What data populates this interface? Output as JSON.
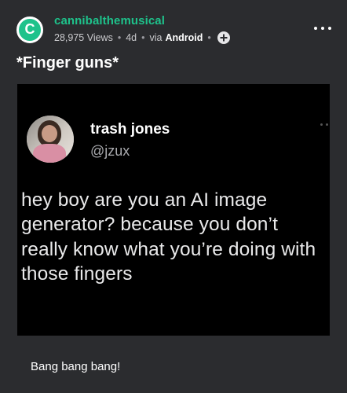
{
  "post": {
    "author": "cannibalthemusical",
    "avatar_letter": "C",
    "views": "28,975 Views",
    "age": "4d",
    "via_label": "via",
    "via_app": "Android",
    "title": "*Finger guns*",
    "caption": "Bang bang bang!"
  },
  "tweet": {
    "name": "trash jones",
    "handle": "@jzux",
    "text": "hey boy are you an AI image generator? because you don’t really know what you’re doing with those fingers"
  },
  "colors": {
    "background": "#2b2c2f",
    "accent": "#1ec28b",
    "media_background": "#000000"
  },
  "icons": [
    "add-icon",
    "more-options-icon"
  ]
}
